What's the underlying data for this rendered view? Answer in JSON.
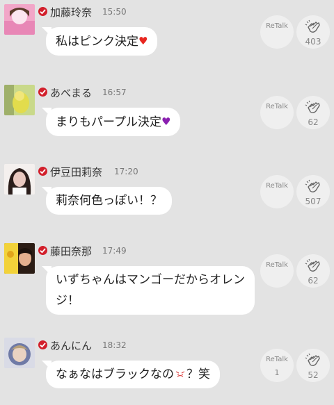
{
  "posts": [
    {
      "name": "加藤玲奈",
      "time": "15:50",
      "message": "私はピンク決定",
      "emoji": "♥",
      "emoji_color": "#e8261f",
      "retalk_label": "ReTalk",
      "retalk_count": "",
      "clap_count": "403",
      "avatar_colors": [
        "#f2a6c8",
        "#e887b6",
        "#fbe6ef"
      ]
    },
    {
      "name": "あべまる",
      "time": "16:57",
      "message": "まりもパープル決定",
      "emoji": "♥",
      "emoji_color": "#8a1fb0",
      "retalk_label": "ReTalk",
      "retalk_count": "",
      "clap_count": "62",
      "avatar_colors": [
        "#c9d98a",
        "#e2dc4c",
        "#9fb06a"
      ]
    },
    {
      "name": "伊豆田莉奈",
      "time": "17:20",
      "message": "莉奈何色っぽい！？",
      "emoji": "",
      "emoji_color": "",
      "retalk_label": "ReTalk",
      "retalk_count": "",
      "clap_count": "507",
      "avatar_colors": [
        "#f4f0ee",
        "#2a1d1a",
        "#e9c9c0"
      ]
    },
    {
      "name": "藤田奈那",
      "time": "17:49",
      "message": "いずちゃんはマンゴーだからオレンジ！",
      "emoji": "",
      "emoji_color": "",
      "retalk_label": "ReTalk",
      "retalk_count": "",
      "clap_count": "62",
      "avatar_colors": [
        "#f2d23a",
        "#2b1c14",
        "#e5b08e"
      ]
    },
    {
      "name": "あんにん",
      "time": "18:32",
      "message": "なぁなはブラックなの",
      "emoji": "😤",
      "suffix": "？笑",
      "emoji_color": "#d44",
      "retalk_label": "ReTalk",
      "retalk_count": "1",
      "clap_count": "52",
      "avatar_colors": [
        "#d9dbe6",
        "#6f7aa6",
        "#b7a07a"
      ]
    }
  ]
}
